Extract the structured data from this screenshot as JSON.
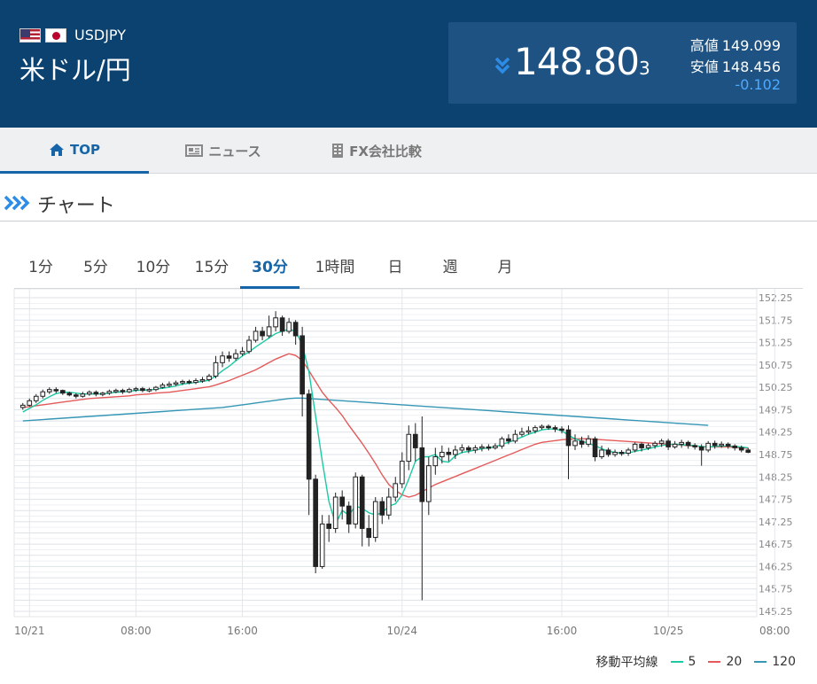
{
  "header": {
    "pair_code": "USDJPY",
    "pair_name": "米ドル/円",
    "rate_main": "148.80",
    "rate_small": "3",
    "direction": "down",
    "high_label": "高値",
    "high_value": "149.099",
    "low_label": "安値",
    "low_value": "148.456",
    "change": "-0.102",
    "colors": {
      "bg": "#0b4270",
      "box": "#1e5282",
      "down": "#2d8ce6",
      "change": "#4ea9ff"
    }
  },
  "tabs": [
    {
      "label": "TOP",
      "icon": "home-icon",
      "active": true
    },
    {
      "label": "ニュース",
      "icon": "newspaper-icon",
      "active": false
    },
    {
      "label": "FX会社比較",
      "icon": "building-icon",
      "active": false
    }
  ],
  "section": {
    "title": "チャート",
    "icon": "chevrons-right-icon"
  },
  "timeframes": [
    {
      "label": "1分",
      "active": false
    },
    {
      "label": "5分",
      "active": false
    },
    {
      "label": "10分",
      "active": false
    },
    {
      "label": "15分",
      "active": false
    },
    {
      "label": "30分",
      "active": true
    },
    {
      "label": "1時間",
      "active": false
    },
    {
      "label": "日",
      "active": false
    },
    {
      "label": "週",
      "active": false
    },
    {
      "label": "月",
      "active": false
    }
  ],
  "chart_data": {
    "type": "candlestick",
    "ylim": [
      145.25,
      152.25
    ],
    "yticks": [
      "152.25",
      "151.75",
      "151.25",
      "150.75",
      "150.25",
      "149.75",
      "149.25",
      "148.75",
      "148.25",
      "147.75",
      "147.25",
      "146.75",
      "146.25",
      "145.75",
      "145.25"
    ],
    "xticks": [
      {
        "label": "10/21",
        "i": 1
      },
      {
        "label": "08:00",
        "i": 17
      },
      {
        "label": "16:00",
        "i": 33
      },
      {
        "label": "10/24",
        "i": 57
      },
      {
        "label": "16:00",
        "i": 81
      },
      {
        "label": "10/25",
        "i": 97
      },
      {
        "label": "08:00",
        "i": 113
      }
    ],
    "candles": [
      [
        149.8,
        149.85,
        149.75,
        149.9
      ],
      [
        149.85,
        149.95,
        149.82,
        150.0
      ],
      [
        149.95,
        150.05,
        149.9,
        150.1
      ],
      [
        150.05,
        150.15,
        150.0,
        150.2
      ],
      [
        150.15,
        150.2,
        150.1,
        150.25
      ],
      [
        150.2,
        150.18,
        150.12,
        150.25
      ],
      [
        150.18,
        150.12,
        150.08,
        150.2
      ],
      [
        150.12,
        150.08,
        150.05,
        150.15
      ],
      [
        150.08,
        150.05,
        150.0,
        150.12
      ],
      [
        150.05,
        150.1,
        150.02,
        150.15
      ],
      [
        150.1,
        150.14,
        150.06,
        150.18
      ],
      [
        150.14,
        150.1,
        150.05,
        150.18
      ],
      [
        150.1,
        150.12,
        150.05,
        150.15
      ],
      [
        150.12,
        150.16,
        150.08,
        150.2
      ],
      [
        150.16,
        150.18,
        150.12,
        150.22
      ],
      [
        150.18,
        150.15,
        150.1,
        150.22
      ],
      [
        150.15,
        150.2,
        150.12,
        150.24
      ],
      [
        150.2,
        150.22,
        150.15,
        150.26
      ],
      [
        150.22,
        150.18,
        150.14,
        150.26
      ],
      [
        150.18,
        150.2,
        150.14,
        150.24
      ],
      [
        150.2,
        150.25,
        150.16,
        150.28
      ],
      [
        150.25,
        150.3,
        150.22,
        150.35
      ],
      [
        150.3,
        150.32,
        150.25,
        150.38
      ],
      [
        150.32,
        150.35,
        150.28,
        150.4
      ],
      [
        150.35,
        150.38,
        150.3,
        150.42
      ],
      [
        150.38,
        150.36,
        150.32,
        150.42
      ],
      [
        150.36,
        150.4,
        150.32,
        150.45
      ],
      [
        150.4,
        150.42,
        150.35,
        150.48
      ],
      [
        150.42,
        150.5,
        150.38,
        150.55
      ],
      [
        150.5,
        150.8,
        150.45,
        150.95
      ],
      [
        150.8,
        150.95,
        150.7,
        151.05
      ],
      [
        150.95,
        150.9,
        150.82,
        151.05
      ],
      [
        150.9,
        151.0,
        150.85,
        151.1
      ],
      [
        151.0,
        151.05,
        150.95,
        151.15
      ],
      [
        151.05,
        151.3,
        151.0,
        151.4
      ],
      [
        151.3,
        151.5,
        151.25,
        151.6
      ],
      [
        151.5,
        151.4,
        151.3,
        151.6
      ],
      [
        151.4,
        151.6,
        151.35,
        151.85
      ],
      [
        151.6,
        151.8,
        151.5,
        151.95
      ],
      [
        151.8,
        151.5,
        151.4,
        151.85
      ],
      [
        151.5,
        151.7,
        151.45,
        151.8
      ],
      [
        151.7,
        151.4,
        151.2,
        151.75
      ],
      [
        151.4,
        150.1,
        149.6,
        151.6
      ],
      [
        150.1,
        148.2,
        147.4,
        150.2
      ],
      [
        148.2,
        146.25,
        146.1,
        148.3
      ],
      [
        146.25,
        147.2,
        146.2,
        147.4
      ],
      [
        147.2,
        147.1,
        146.8,
        147.4
      ],
      [
        147.1,
        147.8,
        147.0,
        147.9
      ],
      [
        147.8,
        147.6,
        147.3,
        147.95
      ],
      [
        147.6,
        147.2,
        147.0,
        147.7
      ],
      [
        147.2,
        148.25,
        147.1,
        148.35
      ],
      [
        148.25,
        147.1,
        146.7,
        148.3
      ],
      [
        147.1,
        146.9,
        146.7,
        147.4
      ],
      [
        146.9,
        147.7,
        146.8,
        147.8
      ],
      [
        147.7,
        147.4,
        147.2,
        147.8
      ],
      [
        147.4,
        147.8,
        147.3,
        148.0
      ],
      [
        147.8,
        148.1,
        147.7,
        148.25
      ],
      [
        148.1,
        148.6,
        148.0,
        148.8
      ],
      [
        148.6,
        149.2,
        148.4,
        149.4
      ],
      [
        149.2,
        148.9,
        148.6,
        149.45
      ],
      [
        148.9,
        147.7,
        145.5,
        149.6
      ],
      [
        147.7,
        148.5,
        147.4,
        148.7
      ],
      [
        148.5,
        148.7,
        148.3,
        148.9
      ],
      [
        148.7,
        148.8,
        148.55,
        148.95
      ],
      [
        148.8,
        148.75,
        148.6,
        148.9
      ],
      [
        148.75,
        148.85,
        148.65,
        148.95
      ],
      [
        148.85,
        148.9,
        148.78,
        148.98
      ],
      [
        148.9,
        148.85,
        148.78,
        148.95
      ],
      [
        148.85,
        148.9,
        148.78,
        148.96
      ],
      [
        148.9,
        148.92,
        148.82,
        148.98
      ],
      [
        148.92,
        148.9,
        148.84,
        148.98
      ],
      [
        148.9,
        148.94,
        148.86,
        149.0
      ],
      [
        148.94,
        149.1,
        148.88,
        149.15
      ],
      [
        149.1,
        149.05,
        148.98,
        149.2
      ],
      [
        149.05,
        149.2,
        149.0,
        149.3
      ],
      [
        149.2,
        149.25,
        149.15,
        149.35
      ],
      [
        149.25,
        149.28,
        149.2,
        149.38
      ],
      [
        149.28,
        149.35,
        149.22,
        149.4
      ],
      [
        149.35,
        149.38,
        149.3,
        149.42
      ],
      [
        149.38,
        149.35,
        149.3,
        149.42
      ],
      [
        149.35,
        149.32,
        149.25,
        149.4
      ],
      [
        149.32,
        149.3,
        149.22,
        149.38
      ],
      [
        149.3,
        148.95,
        148.2,
        149.4
      ],
      [
        148.95,
        149.05,
        148.85,
        149.2
      ],
      [
        149.05,
        148.98,
        148.9,
        149.15
      ],
      [
        148.98,
        149.1,
        148.92,
        149.18
      ],
      [
        149.1,
        148.7,
        148.6,
        149.15
      ],
      [
        148.7,
        148.85,
        148.65,
        148.95
      ],
      [
        148.85,
        148.75,
        148.7,
        148.9
      ],
      [
        148.75,
        148.8,
        148.7,
        148.86
      ],
      [
        148.8,
        148.78,
        148.72,
        148.85
      ],
      [
        148.78,
        148.85,
        148.72,
        148.9
      ],
      [
        148.85,
        148.98,
        148.8,
        149.02
      ],
      [
        148.98,
        148.9,
        148.82,
        149.02
      ],
      [
        148.9,
        148.95,
        148.85,
        149.0
      ],
      [
        148.95,
        149.0,
        148.88,
        149.05
      ],
      [
        149.0,
        149.05,
        148.92,
        149.1
      ],
      [
        149.05,
        148.92,
        148.85,
        149.1
      ],
      [
        148.92,
        148.98,
        148.88,
        149.05
      ],
      [
        148.98,
        149.02,
        148.9,
        149.08
      ],
      [
        149.02,
        148.95,
        148.88,
        149.06
      ],
      [
        148.95,
        148.92,
        148.86,
        149.0
      ],
      [
        148.92,
        148.85,
        148.5,
        148.98
      ],
      [
        148.85,
        149.0,
        148.8,
        149.05
      ],
      [
        149.0,
        148.95,
        148.88,
        149.06
      ],
      [
        148.95,
        148.98,
        148.9,
        149.04
      ],
      [
        148.98,
        148.94,
        148.88,
        149.02
      ],
      [
        148.94,
        148.9,
        148.84,
        148.98
      ],
      [
        148.9,
        148.85,
        148.8,
        148.95
      ],
      [
        148.85,
        148.8,
        148.78,
        148.9
      ]
    ],
    "ma5": [
      149.7,
      149.78,
      149.86,
      149.96,
      150.04,
      150.11,
      150.14,
      150.14,
      150.12,
      150.1,
      150.1,
      150.1,
      150.1,
      150.12,
      150.14,
      150.15,
      150.16,
      150.18,
      150.19,
      150.19,
      150.21,
      150.23,
      150.25,
      150.28,
      150.32,
      150.34,
      150.36,
      150.38,
      150.41,
      150.5,
      150.62,
      150.72,
      150.84,
      150.95,
      151.04,
      151.15,
      151.25,
      151.35,
      151.45,
      151.5,
      151.55,
      151.5,
      151.2,
      150.6,
      149.6,
      148.6,
      147.7,
      147.2,
      147.5,
      147.4,
      147.6,
      147.55,
      147.45,
      147.4,
      147.45,
      147.6,
      147.65,
      147.85,
      148.2,
      148.6,
      148.7,
      148.7,
      148.75,
      148.6,
      148.58,
      148.72,
      148.8,
      148.82,
      148.85,
      148.88,
      148.9,
      148.92,
      148.98,
      149.02,
      149.08,
      149.14,
      149.2,
      149.25,
      149.3,
      149.32,
      149.32,
      149.28,
      149.18,
      149.1,
      149.05,
      149.0,
      148.95,
      148.88,
      148.82,
      148.8,
      148.78,
      148.79,
      148.82,
      148.85,
      148.88,
      148.92,
      148.95,
      148.98,
      148.98,
      148.97,
      148.96,
      148.95,
      148.93,
      148.92,
      148.93,
      148.94,
      148.94,
      148.93,
      148.92,
      148.9
    ],
    "ma20": [
      149.8,
      149.82,
      149.84,
      149.86,
      149.88,
      149.9,
      149.92,
      149.94,
      149.96,
      149.98,
      150.0,
      150.01,
      150.02,
      150.03,
      150.04,
      150.05,
      150.06,
      150.08,
      150.09,
      150.1,
      150.12,
      150.13,
      150.14,
      150.16,
      150.18,
      150.2,
      150.22,
      150.24,
      150.26,
      150.3,
      150.35,
      150.4,
      150.46,
      150.52,
      150.58,
      150.64,
      150.72,
      150.8,
      150.88,
      150.94,
      151.0,
      150.96,
      150.85,
      150.62,
      150.38,
      150.14,
      149.96,
      149.8,
      149.62,
      149.4,
      149.2,
      149.0,
      148.78,
      148.55,
      148.3,
      148.08,
      147.95,
      147.85,
      147.8,
      147.84,
      147.92,
      148.0,
      148.08,
      148.14,
      148.2,
      148.26,
      148.32,
      148.38,
      148.44,
      148.5,
      148.56,
      148.62,
      148.68,
      148.74,
      148.8,
      148.86,
      148.92,
      148.98,
      149.02,
      149.04,
      149.06,
      149.08,
      149.09,
      149.1,
      149.1,
      149.1,
      149.09,
      149.08,
      149.07,
      149.06,
      149.05,
      149.04,
      149.03,
      149.02,
      149.01,
      149.0,
      148.99,
      148.98,
      148.97,
      148.96,
      148.95,
      148.94,
      148.93,
      148.92,
      148.92,
      148.92,
      148.92,
      148.91,
      148.9,
      148.89
    ],
    "ma120": [
      149.5,
      149.51,
      149.52,
      149.53,
      149.54,
      149.55,
      149.56,
      149.57,
      149.58,
      149.59,
      149.6,
      149.61,
      149.62,
      149.63,
      149.64,
      149.65,
      149.66,
      149.67,
      149.68,
      149.69,
      149.7,
      149.71,
      149.72,
      149.73,
      149.74,
      149.75,
      149.76,
      149.77,
      149.78,
      149.79,
      149.8,
      149.82,
      149.84,
      149.86,
      149.88,
      149.9,
      149.92,
      149.94,
      149.96,
      149.98,
      150.0,
      150.01,
      150.01,
      150.0,
      149.99,
      149.98,
      149.97,
      149.96,
      149.95,
      149.94,
      149.93,
      149.92,
      149.91,
      149.9,
      149.89,
      149.88,
      149.87,
      149.86,
      149.85,
      149.84,
      149.83,
      149.82,
      149.81,
      149.8,
      149.79,
      149.78,
      149.77,
      149.76,
      149.75,
      149.74,
      149.73,
      149.72,
      149.71,
      149.7,
      149.69,
      149.68,
      149.67,
      149.66,
      149.65,
      149.64,
      149.63,
      149.62,
      149.61,
      149.6,
      149.59,
      149.58,
      149.57,
      149.56,
      149.55,
      149.54,
      149.53,
      149.52,
      149.51,
      149.5,
      149.49,
      149.48,
      149.47,
      149.46,
      149.45,
      149.44,
      149.43,
      149.42,
      149.41,
      149.4,
      null,
      null,
      null,
      null,
      null,
      null
    ],
    "series_colors": {
      "ma5": "#1dc9a4",
      "ma20": "#e45a5a",
      "ma120": "#3596b5"
    },
    "legend": {
      "label": "移動平均線",
      "items": [
        {
          "name": "5",
          "color": "#1dc9a4"
        },
        {
          "name": "20",
          "color": "#e45a5a"
        },
        {
          "name": "120",
          "color": "#3596b5"
        }
      ]
    },
    "grid": true
  }
}
